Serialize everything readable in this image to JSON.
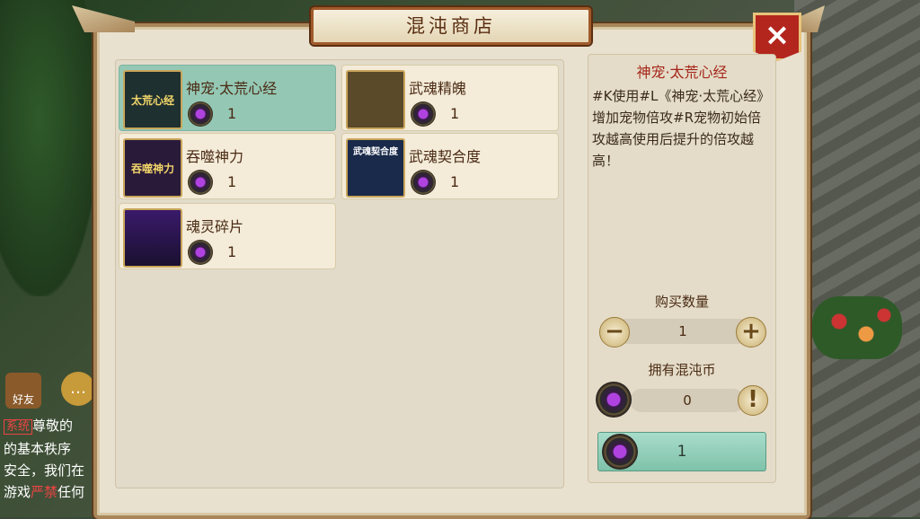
{
  "shop": {
    "title": "混沌商店",
    "close_label": "×"
  },
  "items": [
    {
      "name": "神宠·太荒心经",
      "price": "1",
      "thumb_text": "太荒心经",
      "selected": true
    },
    {
      "name": "武魂精魄",
      "price": "1",
      "thumb_text": "",
      "selected": false
    },
    {
      "name": "吞噬神力",
      "price": "1",
      "thumb_text": "吞噬神力",
      "selected": false
    },
    {
      "name": "武魂契合度",
      "price": "1",
      "thumb_text": "武魂契合度",
      "selected": false
    },
    {
      "name": "魂灵碎片",
      "price": "1",
      "thumb_text": "",
      "selected": false
    }
  ],
  "detail": {
    "title": "神宠·太荒心经",
    "description": "#K使用#L《神宠·太荒心经》增加宠物倍攻#R宠物初始倍攻越高使用后提升的倍攻越高！",
    "quantity_label": "购买数量",
    "quantity_value": "1",
    "minus_label": "−",
    "plus_label": "+",
    "own_label": "拥有混沌币",
    "own_value": "0",
    "info_label": "!",
    "buy_price": "1"
  },
  "chat": {
    "friends_label": "好友",
    "system_tag": "系统",
    "line1": "尊敬的",
    "line2": "的基本秩序",
    "line3": "安全，我们在",
    "line4_a": "游戏",
    "line4_b": "严禁",
    "line4_c": "任何"
  },
  "colors": {
    "selected_item": "#94c8b4",
    "detail_title": "#a5261a",
    "close_button": "#b3261e",
    "buy_button": "#8fcfb8"
  }
}
